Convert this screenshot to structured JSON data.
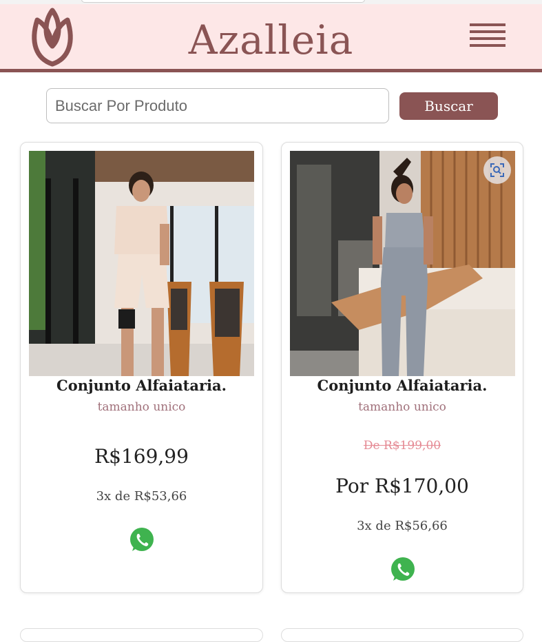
{
  "header": {
    "brand": "Azalleia",
    "logo_icon": "lotus-icon",
    "menu_icon": "hamburger-menu-icon"
  },
  "search": {
    "placeholder": "Buscar Por Produto",
    "value": "",
    "button_label": "Buscar"
  },
  "products": [
    {
      "title": "Conjunto Alfaiataria.",
      "size": "tamanho unico",
      "price": "R$169,99",
      "installments": "3x de R$53,66",
      "contact_icon": "whatsapp-icon"
    },
    {
      "title": "Conjunto Alfaiataria.",
      "size": "tamanho unico",
      "old_price": "De R$199,00",
      "price": "Por R$170,00",
      "installments": "3x de R$56,66",
      "contact_icon": "whatsapp-icon",
      "overlay_icon": "visual-search-icon"
    }
  ],
  "colors": {
    "brand": "#8a5454",
    "header_bg": "#fde7e7",
    "size_text": "#a0707a",
    "old_price": "#e58a94",
    "whatsapp": "#3fb34f"
  }
}
